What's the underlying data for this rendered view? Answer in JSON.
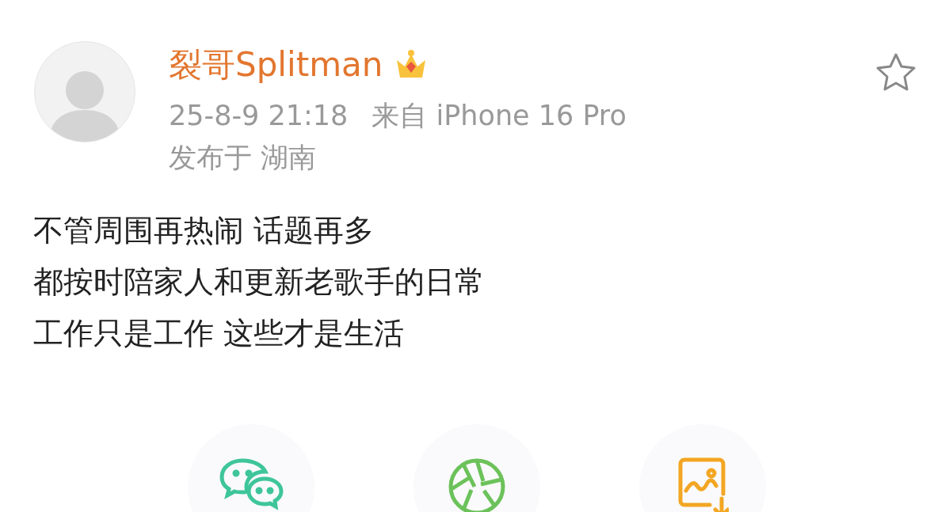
{
  "post": {
    "author": "裂哥Splitman",
    "time": "25-8-9 21:18",
    "source": "来自 iPhone 16 Pro",
    "location": "发布于 湖南",
    "lines": [
      "不管周围再热闹 话题再多",
      "都按时陪家人和更新老歌手的日常",
      "工作只是工作 这些才是生活"
    ]
  },
  "share_targets": [
    {
      "kind": "chat"
    },
    {
      "kind": "moments"
    },
    {
      "kind": "save-image"
    }
  ]
}
